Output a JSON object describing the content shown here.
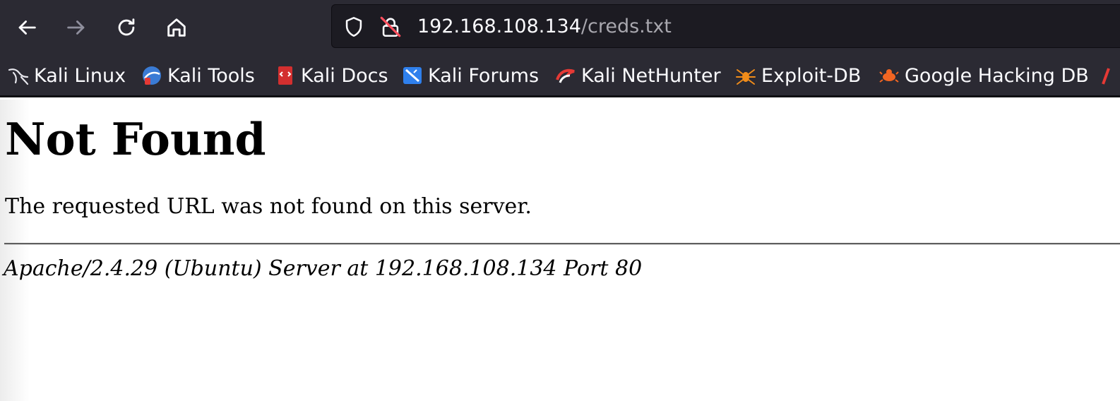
{
  "browser": {
    "nav": {
      "back_icon": "back-arrow-icon",
      "forward_icon": "forward-arrow-icon",
      "reload_icon": "reload-icon",
      "home_icon": "home-icon"
    },
    "url": {
      "host": "192.168.108.134",
      "path": "/creds.txt",
      "shield_icon": "shield-icon",
      "insecure_icon": "insecure-lock-icon"
    },
    "bookmarks": [
      {
        "label": "Kali Linux",
        "icon": "kali-dragon-icon"
      },
      {
        "label": "Kali Tools",
        "icon": "kali-tools-icon"
      },
      {
        "label": "Kali Docs",
        "icon": "kali-docs-icon"
      },
      {
        "label": "Kali Forums",
        "icon": "kali-forums-icon"
      },
      {
        "label": "Kali NetHunter",
        "icon": "kali-nethunter-icon"
      },
      {
        "label": "Exploit-DB",
        "icon": "exploit-db-icon"
      },
      {
        "label": "Google Hacking DB",
        "icon": "ghdb-icon"
      }
    ]
  },
  "page": {
    "title": "Not Found",
    "message": "The requested URL was not found on this server.",
    "server_signature": "Apache/2.4.29 (Ubuntu) Server at 192.168.108.134 Port 80"
  },
  "colors": {
    "chrome": "#2b2a33",
    "urlbar": "#1c1b22",
    "text_light": "#fbfbfe",
    "url_path": "#a8a7ae",
    "disabled_icon": "#8f8f9d"
  }
}
